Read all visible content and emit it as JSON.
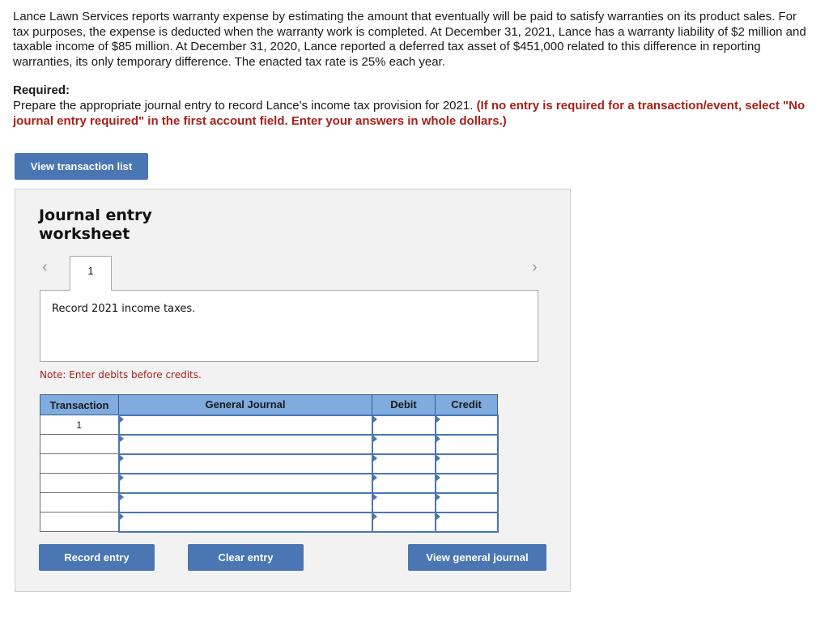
{
  "question": {
    "paragraph": "Lance Lawn Services reports warranty expense by estimating the amount that eventually will be paid to satisfy warranties on its product sales. For tax purposes, the expense is deducted when the warranty work is completed. At December 31, 2021, Lance has a warranty liability of $2 million and taxable income of $85 million. At December 31, 2020, Lance reported a deferred tax asset of $451,000 related to this difference in reporting warranties, its only temporary difference. The enacted tax rate is 25% each year."
  },
  "required": {
    "title": "Required:",
    "text": "Prepare the appropriate journal entry to record Lance’s income tax provision for 2021. ",
    "instruction": "(If no entry is required for a transaction/event, select \"No journal entry required\" in the first account field. Enter your answers in whole dollars.)"
  },
  "buttons": {
    "view_transaction_list": "View transaction list",
    "record_entry": "Record entry",
    "clear_entry": "Clear entry",
    "view_general_journal": "View general journal"
  },
  "worksheet": {
    "title_line1": "Journal entry",
    "title_line2": "worksheet",
    "prev_icon": "‹",
    "next_icon": "›",
    "active_tab": "1",
    "description": "Record 2021 income taxes.",
    "note": "Note: Enter debits before credits."
  },
  "table": {
    "headers": [
      "Transaction",
      "General Journal",
      "Debit",
      "Credit"
    ],
    "rows": [
      {
        "transaction": "1",
        "account": "",
        "debit": "",
        "credit": ""
      },
      {
        "transaction": "",
        "account": "",
        "debit": "",
        "credit": ""
      },
      {
        "transaction": "",
        "account": "",
        "debit": "",
        "credit": ""
      },
      {
        "transaction": "",
        "account": "",
        "debit": "",
        "credit": ""
      },
      {
        "transaction": "",
        "account": "",
        "debit": "",
        "credit": ""
      },
      {
        "transaction": "",
        "account": "",
        "debit": "",
        "credit": ""
      }
    ]
  },
  "colors": {
    "button_blue": "#4a76b4",
    "header_blue": "#7fabde",
    "note_red": "#a8201a"
  }
}
